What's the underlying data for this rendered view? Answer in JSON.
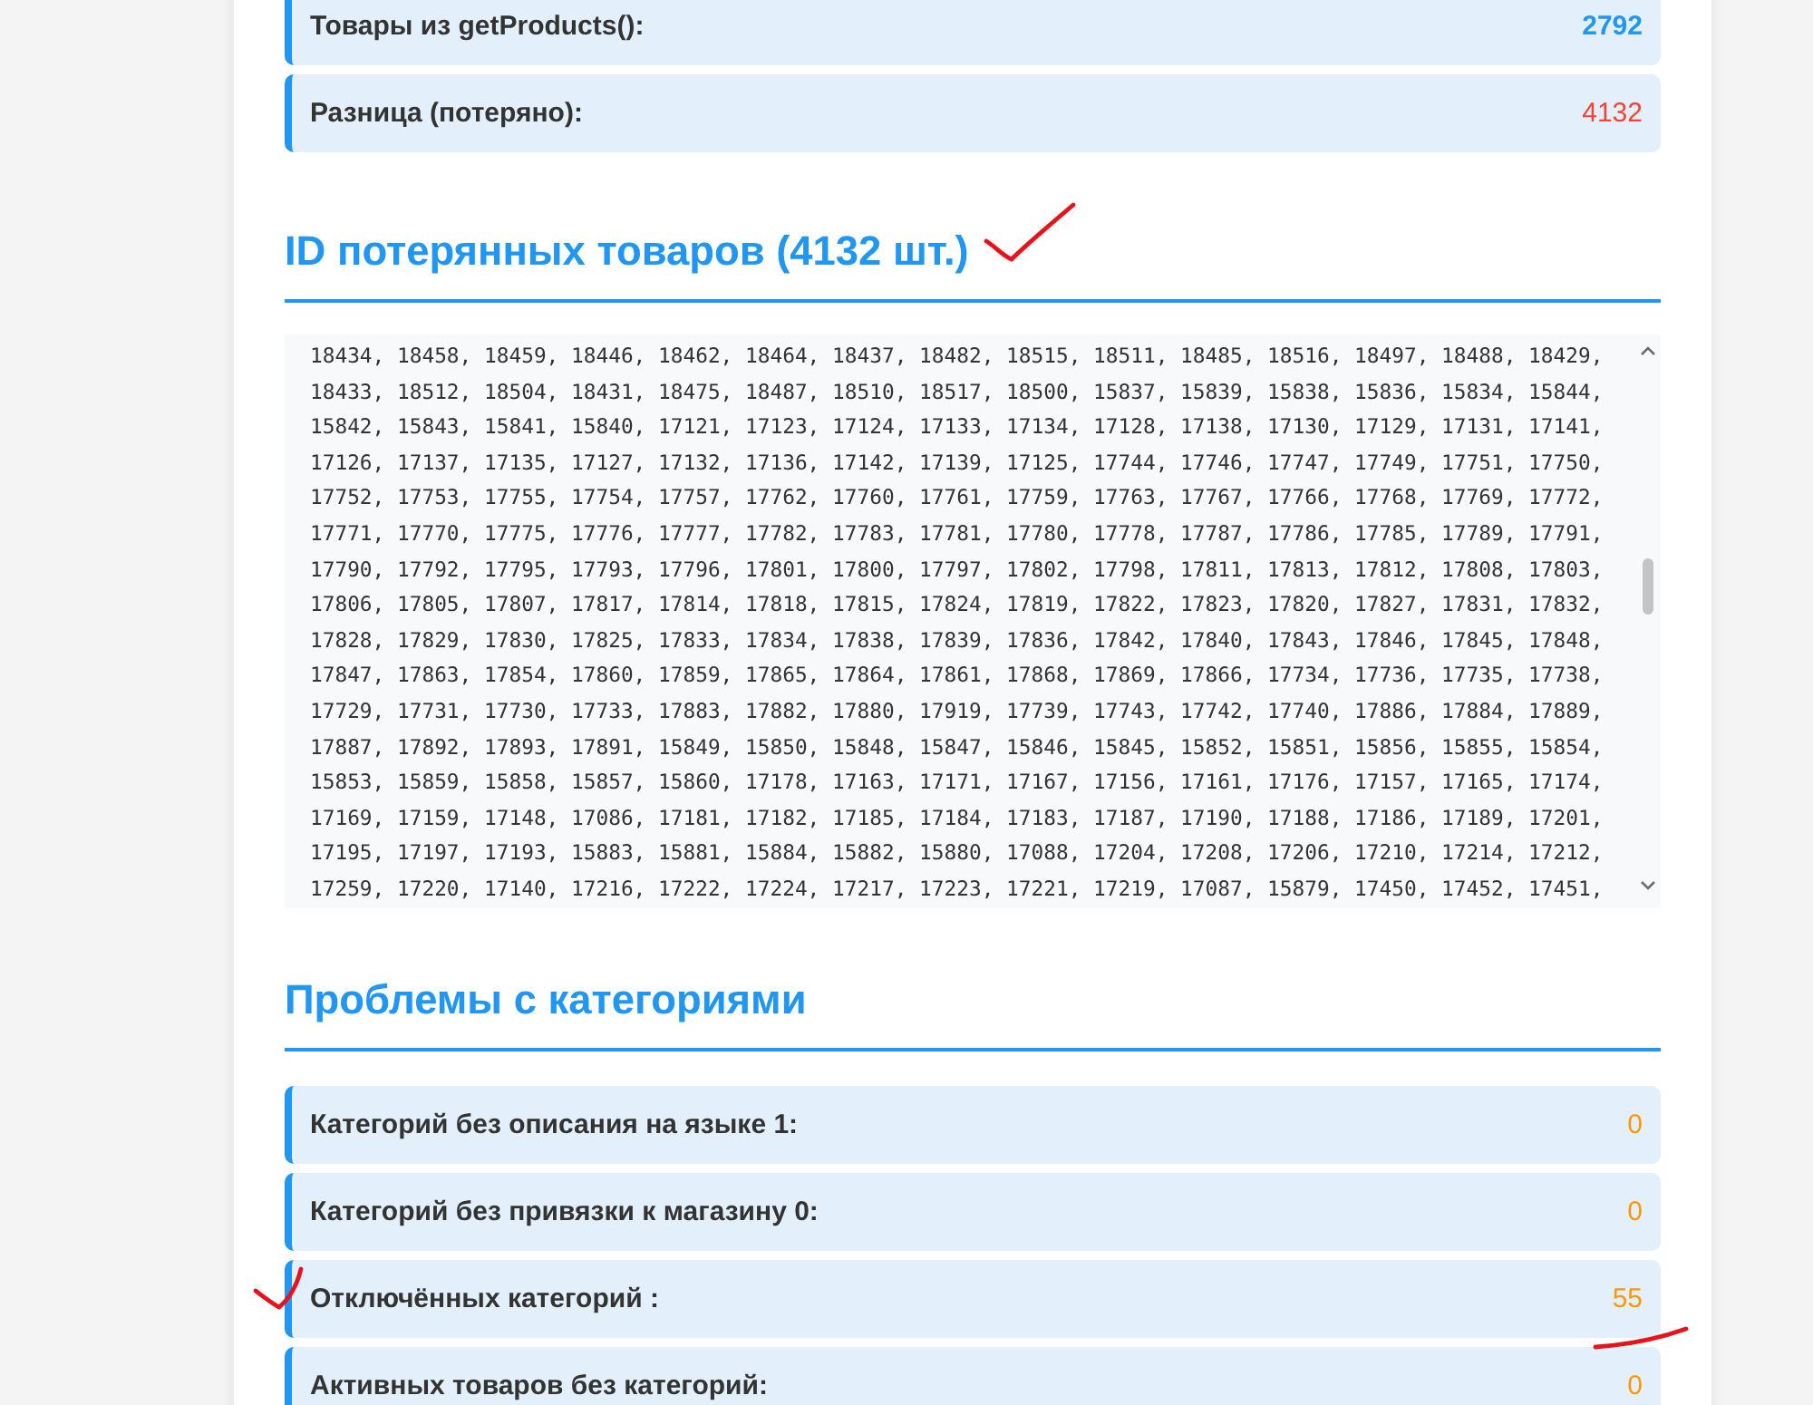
{
  "stats": [
    {
      "label": "Товары из getProducts():",
      "value": "2792",
      "color": "#2196f3",
      "value_bold": true
    },
    {
      "label": "Разница (потеряно):",
      "value": "4132",
      "color": "#f44336",
      "value_bold": false
    }
  ],
  "lost_ids": {
    "title": "ID потерянных товаров (4132 шт.)",
    "lines": [
      "18434, 18458, 18459, 18446, 18462, 18464, 18437, 18482, 18515, 18511, 18485, 18516, 18497, 18488, 18429,",
      "18433, 18512, 18504, 18431, 18475, 18487, 18510, 18517, 18500, 15837, 15839, 15838, 15836, 15834, 15844,",
      "15842, 15843, 15841, 15840, 17121, 17123, 17124, 17133, 17134, 17128, 17138, 17130, 17129, 17131, 17141,",
      "17126, 17137, 17135, 17127, 17132, 17136, 17142, 17139, 17125, 17744, 17746, 17747, 17749, 17751, 17750,",
      "17752, 17753, 17755, 17754, 17757, 17762, 17760, 17761, 17759, 17763, 17767, 17766, 17768, 17769, 17772,",
      "17771, 17770, 17775, 17776, 17777, 17782, 17783, 17781, 17780, 17778, 17787, 17786, 17785, 17789, 17791,",
      "17790, 17792, 17795, 17793, 17796, 17801, 17800, 17797, 17802, 17798, 17811, 17813, 17812, 17808, 17803,",
      "17806, 17805, 17807, 17817, 17814, 17818, 17815, 17824, 17819, 17822, 17823, 17820, 17827, 17831, 17832,",
      "17828, 17829, 17830, 17825, 17833, 17834, 17838, 17839, 17836, 17842, 17840, 17843, 17846, 17845, 17848,",
      "17847, 17863, 17854, 17860, 17859, 17865, 17864, 17861, 17868, 17869, 17866, 17734, 17736, 17735, 17738,",
      "17729, 17731, 17730, 17733, 17883, 17882, 17880, 17919, 17739, 17743, 17742, 17740, 17886, 17884, 17889,",
      "17887, 17892, 17893, 17891, 15849, 15850, 15848, 15847, 15846, 15845, 15852, 15851, 15856, 15855, 15854,",
      "15853, 15859, 15858, 15857, 15860, 17178, 17163, 17171, 17167, 17156, 17161, 17176, 17157, 17165, 17174,",
      "17169, 17159, 17148, 17086, 17181, 17182, 17185, 17184, 17183, 17187, 17190, 17188, 17186, 17189, 17201,",
      "17195, 17197, 17193, 15883, 15881, 15884, 15882, 15880, 17088, 17204, 17208, 17206, 17210, 17214, 17212,",
      "17259, 17220, 17140, 17216, 17222, 17224, 17217, 17223, 17221, 17219, 17087, 15879, 17450, 17452, 17451,"
    ]
  },
  "category_problems": {
    "title": "Проблемы с категориями",
    "rows": [
      {
        "label": "Категорий без описания на языке 1:",
        "value": "0",
        "color": "#ff9800",
        "value_bold": false
      },
      {
        "label": "Категорий без привязки к магазину 0:",
        "value": "0",
        "color": "#ff9800",
        "value_bold": false
      },
      {
        "label": "Отключённых категорий :",
        "value": "55",
        "color": "#ff9800",
        "value_bold": false
      },
      {
        "label": "Активных товаров без категорий:",
        "value": "0",
        "color": "#ff9800",
        "value_bold": false
      }
    ]
  }
}
